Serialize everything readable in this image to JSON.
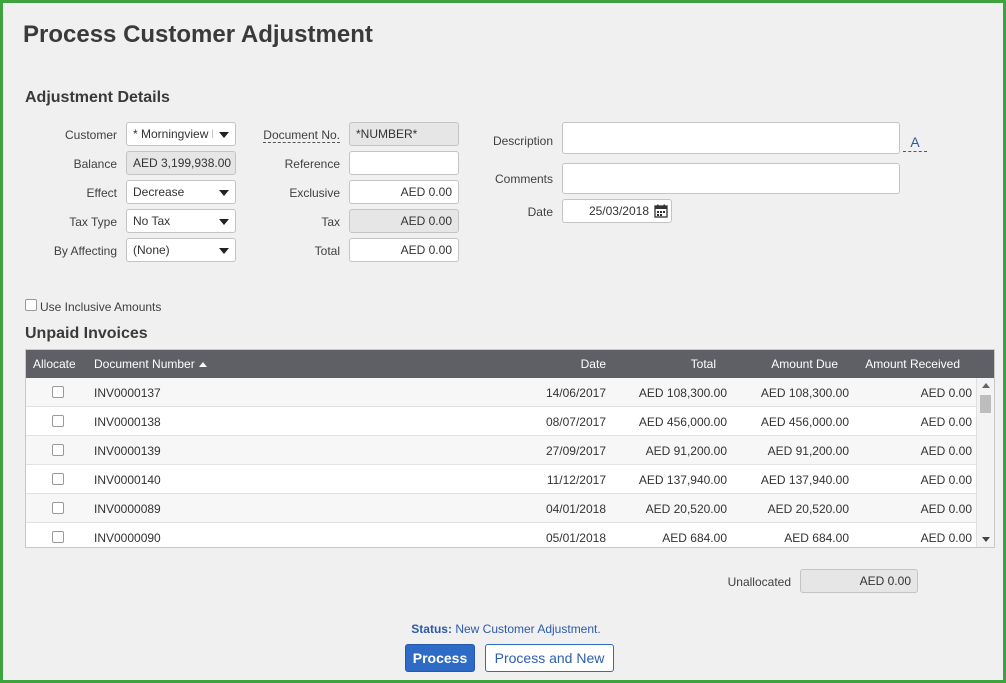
{
  "page": {
    "title": "Process Customer Adjustment"
  },
  "details": {
    "section_title": "Adjustment Details",
    "customer": {
      "label": "Customer",
      "value": "* Morningview Bi("
    },
    "balance": {
      "label": "Balance",
      "value": "AED 3,199,938.00"
    },
    "effect": {
      "label": "Effect",
      "value": "Decrease"
    },
    "tax_type": {
      "label": "Tax Type",
      "value": "No Tax"
    },
    "by_affecting": {
      "label": "By Affecting",
      "value": "(None)"
    },
    "document_no": {
      "label": "Document No.",
      "value": "*NUMBER*"
    },
    "reference": {
      "label": "Reference",
      "value": ""
    },
    "exclusive": {
      "label": "Exclusive",
      "value": "AED 0.00"
    },
    "tax": {
      "label": "Tax",
      "value": "AED 0.00"
    },
    "total": {
      "label": "Total",
      "value": "AED 0.00"
    },
    "description": {
      "label": "Description",
      "value": "",
      "font_button": "A"
    },
    "comments": {
      "label": "Comments",
      "value": ""
    },
    "date": {
      "label": "Date",
      "value": "25/03/2018"
    },
    "use_inclusive": {
      "label": "Use Inclusive Amounts",
      "checked": false
    }
  },
  "invoices": {
    "section_title": "Unpaid Invoices",
    "columns": {
      "allocate": "Allocate",
      "document_number": "Document Number",
      "date": "Date",
      "total": "Total",
      "amount_due": "Amount Due",
      "amount_received": "Amount Received"
    },
    "rows": [
      {
        "doc": "INV0000137",
        "date": "14/06/2017",
        "total": "AED 108,300.00",
        "due": "AED 108,300.00",
        "received": "AED 0.00"
      },
      {
        "doc": "INV0000138",
        "date": "08/07/2017",
        "total": "AED 456,000.00",
        "due": "AED 456,000.00",
        "received": "AED 0.00"
      },
      {
        "doc": "INV0000139",
        "date": "27/09/2017",
        "total": "AED 91,200.00",
        "due": "AED 91,200.00",
        "received": "AED 0.00"
      },
      {
        "doc": "INV0000140",
        "date": "11/12/2017",
        "total": "AED 137,940.00",
        "due": "AED 137,940.00",
        "received": "AED 0.00"
      },
      {
        "doc": "INV0000089",
        "date": "04/01/2018",
        "total": "AED 20,520.00",
        "due": "AED 20,520.00",
        "received": "AED 0.00"
      },
      {
        "doc": "INV0000090",
        "date": "05/01/2018",
        "total": "AED 684.00",
        "due": "AED 684.00",
        "received": "AED 0.00"
      }
    ]
  },
  "unallocated": {
    "label": "Unallocated",
    "value": "AED 0.00"
  },
  "status": {
    "label": "Status:",
    "text": "New Customer Adjustment."
  },
  "buttons": {
    "process": "Process",
    "process_and_new": "Process and New"
  },
  "colors": {
    "accent": "#2e6bc6",
    "header": "#5e6066",
    "frame": "#3ea33e"
  }
}
